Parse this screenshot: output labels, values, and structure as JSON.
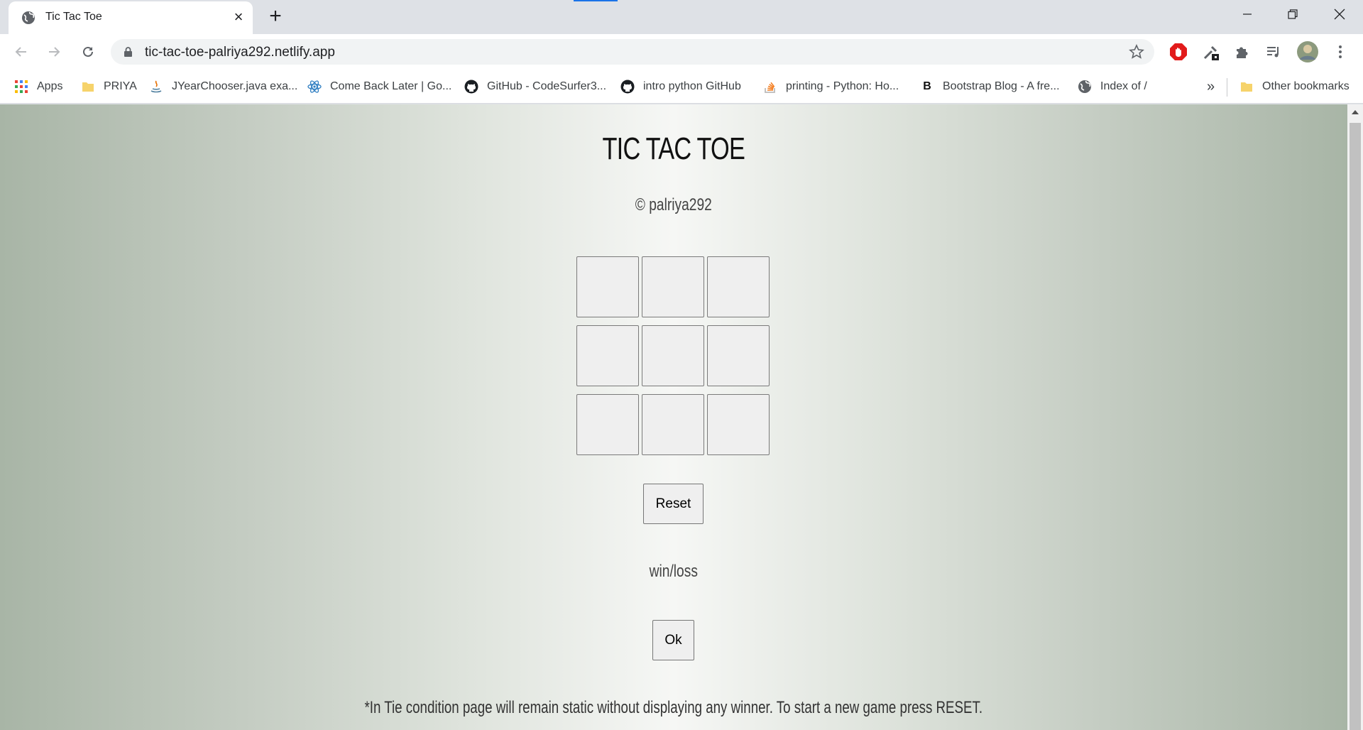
{
  "browser": {
    "tab": {
      "title": "Tic Tac Toe",
      "favicon": "globe-icon"
    },
    "url": "tic-tac-toe-palriya292.netlify.app",
    "bookmarks": [
      {
        "label": "Apps",
        "icon": "apps-grid-icon"
      },
      {
        "label": "PRIYA",
        "icon": "folder-icon"
      },
      {
        "label": "JYearChooser.java exa...",
        "icon": "java-icon"
      },
      {
        "label": "Come Back Later | Go...",
        "icon": "react-icon"
      },
      {
        "label": "GitHub - CodeSurfer3...",
        "icon": "github-icon"
      },
      {
        "label": "intro python GitHub",
        "icon": "github-icon"
      },
      {
        "label": "printing - Python: Ho...",
        "icon": "stackoverflow-icon"
      },
      {
        "label": "Bootstrap Blog - A fre...",
        "icon": "bootstrap-icon"
      },
      {
        "label": "Index of /",
        "icon": "globe-icon"
      }
    ],
    "overflow": "»",
    "other_bookmarks": "Other bookmarks"
  },
  "page": {
    "title": "TIC TAC TOE",
    "credit": "© palriya292",
    "board": [
      "",
      "",
      "",
      "",
      "",
      "",
      "",
      "",
      ""
    ],
    "reset_label": "Reset",
    "status_text": "win/loss",
    "ok_label": "Ok",
    "footnote": "*In Tie condition page will remain static without displaying any winner. To start a new game press RESET."
  }
}
